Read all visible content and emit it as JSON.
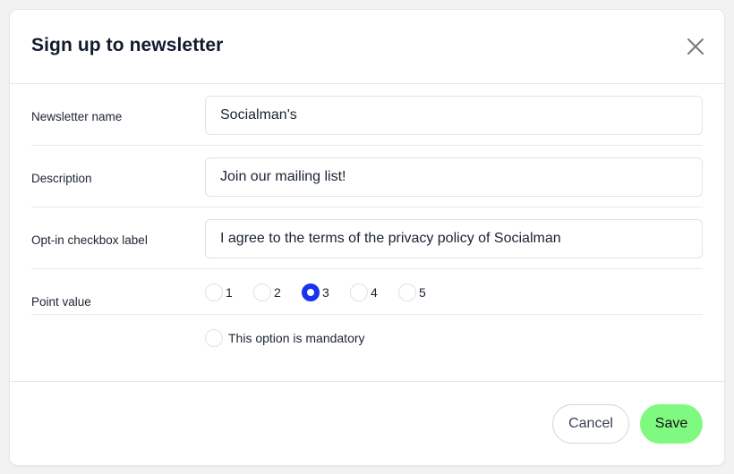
{
  "dialog": {
    "title": "Sign up to newsletter",
    "close_icon": "close-icon"
  },
  "form": {
    "newsletter_name": {
      "label": "Newsletter name",
      "value": "Socialman's"
    },
    "description": {
      "label": "Description",
      "value": "Join our mailing list!"
    },
    "opt_in_label": {
      "label": "Opt-in checkbox label",
      "value": "I agree to the terms of the privacy policy of Socialman"
    },
    "point_value": {
      "label": "Point value",
      "options": [
        "1",
        "2",
        "3",
        "4",
        "5"
      ],
      "selected": "3"
    },
    "mandatory": {
      "label": "This option is mandatory",
      "checked": false
    }
  },
  "footer": {
    "cancel_label": "Cancel",
    "save_label": "Save"
  },
  "colors": {
    "accent": "#1734f0",
    "save_button": "#80f980"
  }
}
